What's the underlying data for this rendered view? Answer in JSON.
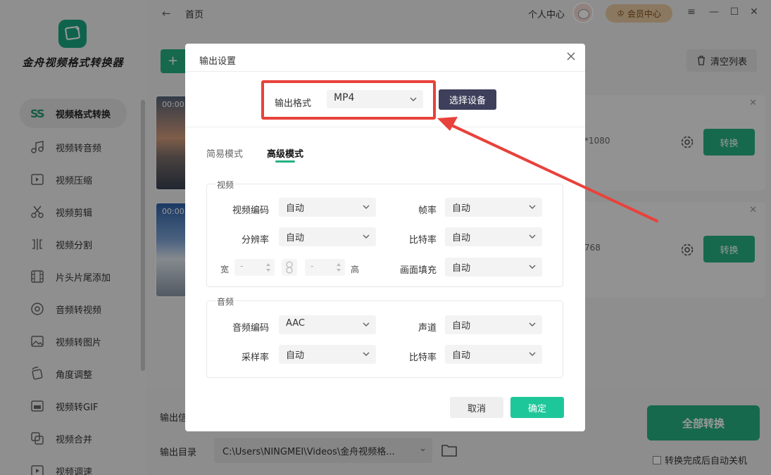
{
  "app": {
    "name": "金舟视频格式转换器",
    "breadcrumb_home": "首页",
    "user_center": "个人中心",
    "vip_label": "会员中心",
    "clear_list": "清空列表"
  },
  "sidebar": {
    "items": [
      {
        "label": "视频格式转换",
        "icon": "convert-icon"
      },
      {
        "label": "视频转音频",
        "icon": "music-icon"
      },
      {
        "label": "视频压缩",
        "icon": "compress-icon"
      },
      {
        "label": "视频剪辑",
        "icon": "scissors-icon"
      },
      {
        "label": "视频分割",
        "icon": "split-icon"
      },
      {
        "label": "片头片尾添加",
        "icon": "film-strip-icon"
      },
      {
        "label": "音频转视频",
        "icon": "audio-disc-icon"
      },
      {
        "label": "视频转图片",
        "icon": "image-icon"
      },
      {
        "label": "角度调整",
        "icon": "rotate-icon"
      },
      {
        "label": "视频转GIF",
        "icon": "gif-icon"
      },
      {
        "label": "视频合并",
        "icon": "merge-icon"
      },
      {
        "label": "视频调速",
        "icon": "speed-icon"
      }
    ]
  },
  "files": [
    {
      "time": "00:00:",
      "resolution": "*1080",
      "convert": "转换"
    },
    {
      "time": "00:00:",
      "resolution": "768",
      "convert": "转换"
    }
  ],
  "bottom": {
    "output_info_label": "输出信",
    "output_dir_label": "输出目录",
    "output_dir_value": "C:\\Users\\NINGMEI\\Videos\\金舟视频格...",
    "convert_all": "全部转换",
    "auto_shutdown": "转换完成后自动关机"
  },
  "dialog": {
    "title": "输出设置",
    "format_label": "输出格式",
    "format_value": "MP4",
    "select_device": "选择设备",
    "tabs": {
      "simple": "简易模式",
      "advanced": "高级模式"
    },
    "video": {
      "title": "视频",
      "codec_label": "视频编码",
      "codec_value": "自动",
      "fps_label": "帧率",
      "fps_value": "自动",
      "resolution_label": "分辨率",
      "resolution_value": "自动",
      "bitrate_label": "比特率",
      "bitrate_value": "自动",
      "width_label": "宽",
      "width_value": "-",
      "height_label": "高",
      "height_value": "-",
      "fill_label": "画面填充",
      "fill_value": "自动"
    },
    "audio": {
      "title": "音频",
      "codec_label": "音频编码",
      "codec_value": "AAC",
      "channel_label": "声道",
      "channel_value": "自动",
      "samplerate_label": "采样率",
      "samplerate_value": "自动",
      "bitrate_label": "比特率",
      "bitrate_value": "自动"
    },
    "cancel": "取消",
    "confirm": "确定"
  },
  "colors": {
    "accent": "#27b083",
    "confirm": "#1ec79a",
    "device_button": "#3d3f5b",
    "highlight": "#e8423b"
  }
}
